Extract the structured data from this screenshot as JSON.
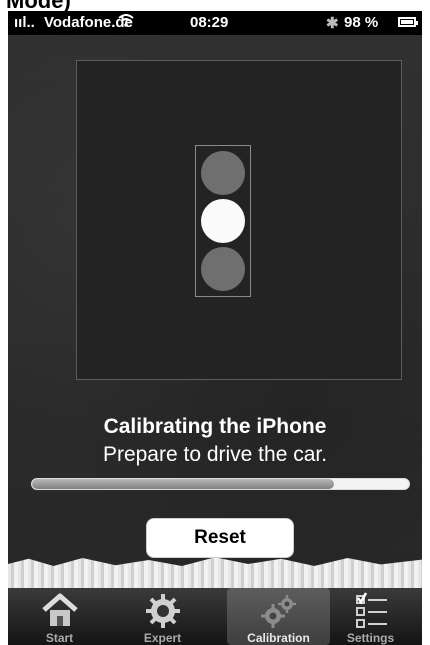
{
  "page": {
    "title": "Mode)"
  },
  "status": {
    "signal": "ııl..",
    "carrier": "Vodafone.de",
    "wifi_icon": "wifi-icon",
    "time": "08:29",
    "bluetooth": "✱",
    "battery": "98 %"
  },
  "main": {
    "headline": "Calibrating the iPhone",
    "subtitle": "Prepare to drive the car.",
    "progress": 0.8,
    "reset_label": "Reset",
    "traffic_light": {
      "top": "off",
      "middle": "on",
      "bottom": "off"
    }
  },
  "tabs": [
    {
      "label": "Start",
      "icon": "house-icon",
      "active": false
    },
    {
      "label": "Expert",
      "icon": "gear-icon",
      "active": false
    },
    {
      "label": "Calibration",
      "icon": "gears-icon",
      "active": true
    },
    {
      "label": "Settings",
      "icon": "checklist-icon",
      "active": false
    }
  ],
  "colors": {
    "background": "#2e2e2e",
    "tabbar": "#141414",
    "lamp_on": "#fafafa",
    "lamp_off": "#6f6f6f"
  }
}
